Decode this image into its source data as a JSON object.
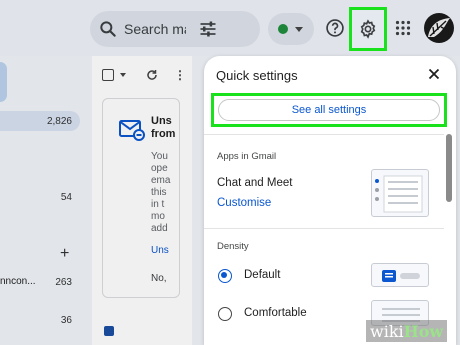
{
  "topbar": {
    "search_placeholder": "Search ma",
    "status_color": "#1e8e3e"
  },
  "sidebar": {
    "counts": [
      "2,826",
      "54",
      "263",
      "36"
    ],
    "label_truncated": "nncon..."
  },
  "email_card": {
    "title_lines": [
      "Uns",
      "from"
    ],
    "body_lines": [
      "You",
      "ope",
      "ema",
      "this",
      "in t",
      "mo",
      "add"
    ],
    "link": "Uns",
    "footer": "No,"
  },
  "quick_settings": {
    "title": "Quick settings",
    "see_all_button": "See all settings",
    "apps_section": "Apps in Gmail",
    "chat_meet_label": "Chat and Meet",
    "customise_link": "Customise",
    "density_section": "Density",
    "density_options": [
      {
        "label": "Default",
        "selected": true
      },
      {
        "label": "Comfortable",
        "selected": false
      }
    ]
  },
  "highlight_color": "#19e11b",
  "watermark": {
    "prefix": "wiki",
    "suffix": "How"
  }
}
